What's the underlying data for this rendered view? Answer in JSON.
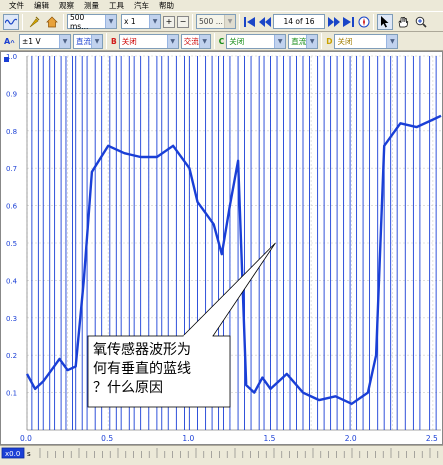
{
  "menu": [
    "文件",
    "编辑",
    "观察",
    "测量",
    "工具",
    "汽车",
    "帮助"
  ],
  "toolbar": {
    "timebase": "500 ms...",
    "multiplier": "x 1",
    "samples": "500 ...",
    "page": "14 of 16"
  },
  "channels": {
    "a": {
      "label": "A",
      "range": "±1 V",
      "coupling": "直流"
    },
    "b": {
      "label": "B",
      "range": "关闭",
      "coupling": "交流"
    },
    "c": {
      "label": "C",
      "range": "关闭",
      "coupling": "直流"
    },
    "d": {
      "label": "D",
      "range": "关闭"
    }
  },
  "colors": {
    "trace": "#1a3fd6",
    "grid": "#cccccc",
    "axis_text": "#1a3fd6",
    "callout_text": "#000000"
  },
  "chart_data": {
    "type": "line",
    "y_ticks": [
      "0.1",
      "0.2",
      "0.3",
      "0.4",
      "0.5",
      "0.6",
      "0.7",
      "0.8",
      "0.9",
      "1.0"
    ],
    "x_ticks": [
      "0.0",
      "0.5",
      "1.0",
      "1.5",
      "2.0",
      "2.5"
    ],
    "ylim": [
      0,
      1.0
    ],
    "xlim": [
      0,
      2.55
    ],
    "x_unit": "s",
    "y_unit": "V",
    "grid": true,
    "series": [
      {
        "x": [
          0.0,
          0.05,
          0.1,
          0.15,
          0.2,
          0.25,
          0.3,
          0.35,
          0.4,
          0.5,
          0.6,
          0.7,
          0.8,
          0.9,
          1.0,
          1.05,
          1.1,
          1.15,
          1.2,
          1.25,
          1.3,
          1.35,
          1.4,
          1.45,
          1.5,
          1.6,
          1.7,
          1.8,
          1.9,
          2.0,
          2.1,
          2.15,
          2.2,
          2.3,
          2.4,
          2.5,
          2.55
        ],
        "y": [
          0.15,
          0.11,
          0.13,
          0.16,
          0.19,
          0.16,
          0.17,
          0.4,
          0.69,
          0.76,
          0.74,
          0.73,
          0.73,
          0.76,
          0.7,
          0.61,
          0.58,
          0.55,
          0.47,
          0.6,
          0.72,
          0.12,
          0.1,
          0.14,
          0.11,
          0.15,
          0.1,
          0.08,
          0.09,
          0.07,
          0.1,
          0.2,
          0.76,
          0.82,
          0.81,
          0.83,
          0.84
        ]
      }
    ],
    "spikes_x": [
      0.03,
      0.07,
      0.1,
      0.14,
      0.17,
      0.21,
      0.24,
      0.28,
      0.3,
      0.34,
      0.37,
      0.42,
      0.46,
      0.51,
      0.55,
      0.58,
      0.63,
      0.66,
      0.7,
      0.75,
      0.8,
      0.83,
      0.87,
      0.92,
      0.97,
      1.0,
      1.05,
      1.1,
      1.14,
      1.18,
      1.21,
      1.25,
      1.3,
      1.34,
      1.38,
      1.43,
      1.46,
      1.5,
      1.54,
      1.58,
      1.62,
      1.66,
      1.7,
      1.74,
      1.79,
      1.83,
      1.87,
      1.91,
      1.95,
      1.99,
      2.03,
      2.07,
      2.11,
      2.16,
      2.2,
      2.24,
      2.28,
      2.33,
      2.38,
      2.42,
      2.48,
      2.52
    ],
    "annotation": "氧传感器波形为何有垂直的蓝线？什么原因"
  },
  "status": {
    "ref_label": "x0.0",
    "unit": "s"
  }
}
